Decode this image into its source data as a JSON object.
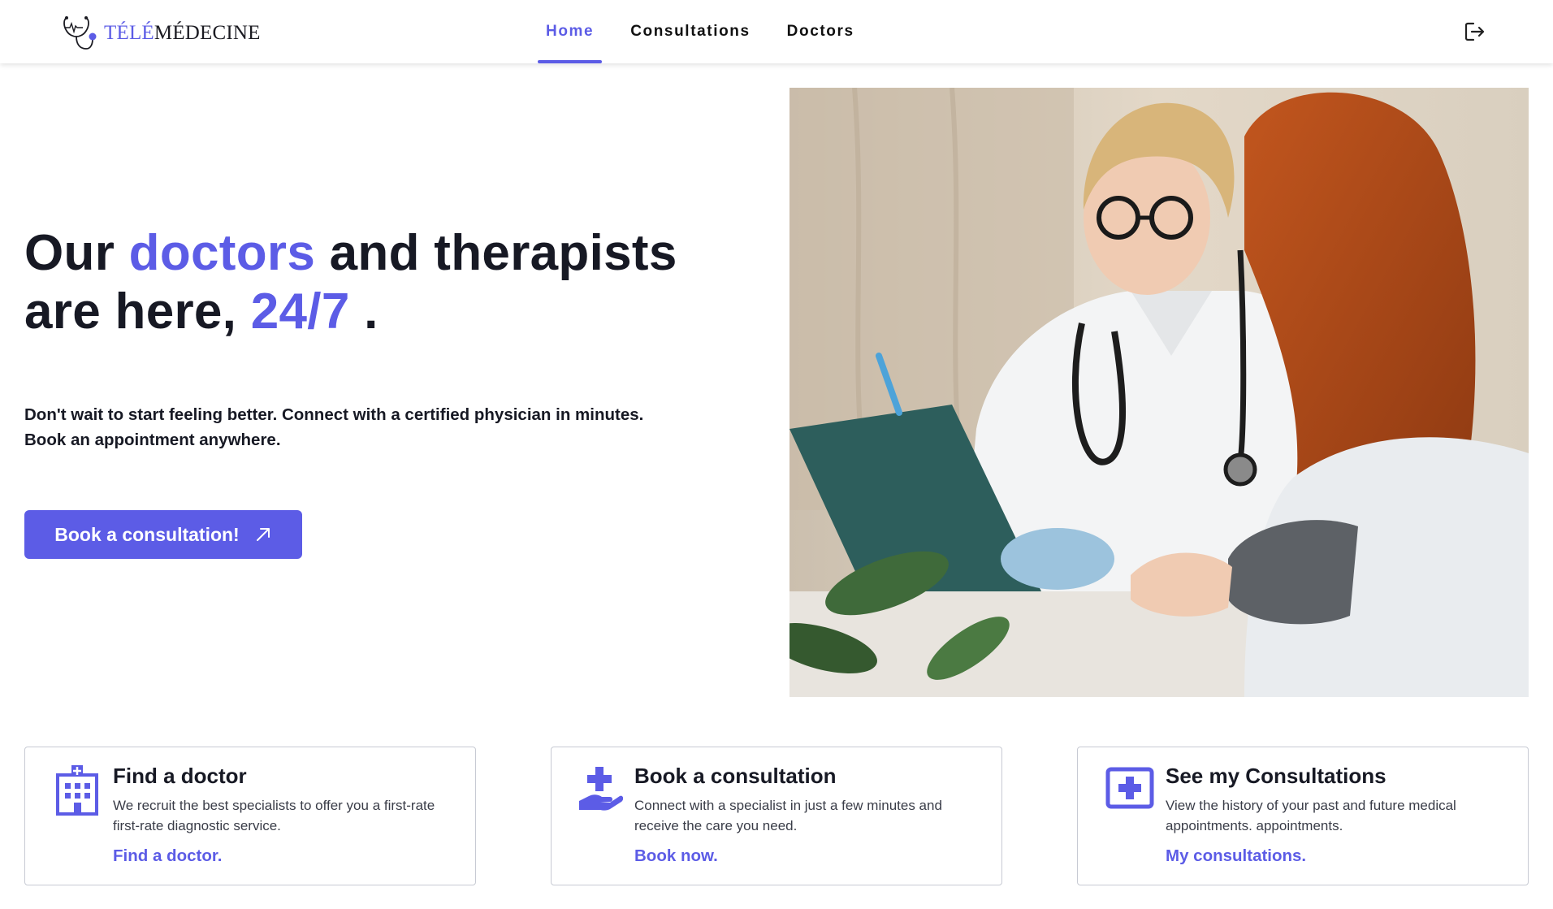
{
  "header": {
    "logo_part_accent": "TÉLÉ",
    "logo_part_main": "MÉDECINE",
    "nav": [
      {
        "label": "Home",
        "active": true
      },
      {
        "label": "Consultations",
        "active": false
      },
      {
        "label": "Doctors",
        "active": false
      }
    ],
    "logout_icon": "logout-icon"
  },
  "hero": {
    "title_part1": "Our ",
    "title_accent1": "doctors",
    "title_part2": " and therapists are here, ",
    "title_accent2": "24/7",
    "title_part3": " .",
    "subtitle_line1": "Don't wait to start feeling better. Connect with a certified physician in minutes.",
    "subtitle_line2": "Book an appointment anywhere.",
    "cta_label": "Book a consultation!",
    "cta_icon": "arrow-up-right-icon",
    "image_icon": "doctor-patient-photo"
  },
  "cards": [
    {
      "icon": "hospital-building-icon",
      "title": "Find a doctor",
      "description": "We recruit the best specialists to offer you a first-rate first-rate diagnostic service.",
      "link": "Find a doctor."
    },
    {
      "icon": "hand-plus-icon",
      "title": "Book a consultation",
      "description": "Connect with a specialist in just a few minutes and receive the care you need.",
      "link": "Book now."
    },
    {
      "icon": "medical-plus-box-icon",
      "title": "See my Consultations",
      "description": "View the history of your past and future medical appointments. appointments.",
      "link": "My consultations."
    }
  ],
  "colors": {
    "accent": "#5c5ce6",
    "text": "#171924",
    "border": "#c7cad3"
  }
}
